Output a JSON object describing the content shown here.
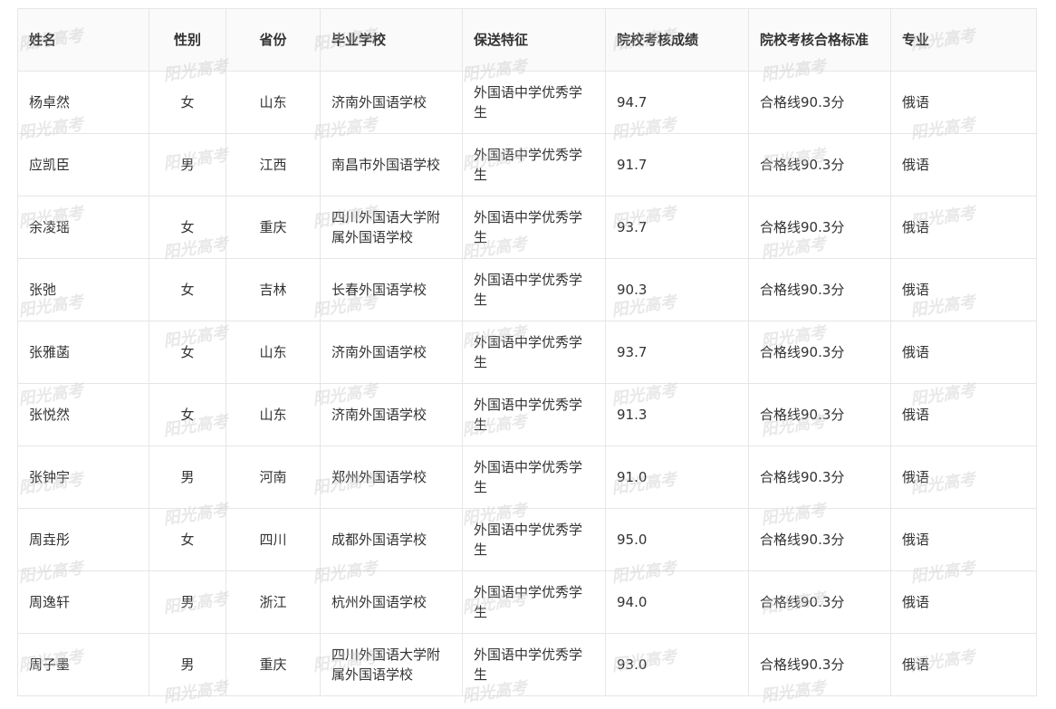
{
  "table": {
    "headers": [
      "姓名",
      "性别",
      "省份",
      "毕业学校",
      "保送特征",
      "院校考核成绩",
      "院校考核合格标准",
      "专业"
    ],
    "rows": [
      [
        "杨卓然",
        "女",
        "山东",
        "济南外国语学校",
        "外国语中学优秀学生",
        "94.7",
        "合格线90.3分",
        "俄语"
      ],
      [
        "应凯臣",
        "男",
        "江西",
        "南昌市外国语学校",
        "外国语中学优秀学生",
        "91.7",
        "合格线90.3分",
        "俄语"
      ],
      [
        "余凌瑶",
        "女",
        "重庆",
        "四川外国语大学附属外国语学校",
        "外国语中学优秀学生",
        "93.7",
        "合格线90.3分",
        "俄语"
      ],
      [
        "张弛",
        "女",
        "吉林",
        "长春外国语学校",
        "外国语中学优秀学生",
        "90.3",
        "合格线90.3分",
        "俄语"
      ],
      [
        "张雅菡",
        "女",
        "山东",
        "济南外国语学校",
        "外国语中学优秀学生",
        "93.7",
        "合格线90.3分",
        "俄语"
      ],
      [
        "张悦然",
        "女",
        "山东",
        "济南外国语学校",
        "外国语中学优秀学生",
        "91.3",
        "合格线90.3分",
        "俄语"
      ],
      [
        "张钟宇",
        "男",
        "河南",
        "郑州外国语学校",
        "外国语中学优秀学生",
        "91.0",
        "合格线90.3分",
        "俄语"
      ],
      [
        "周垚彤",
        "女",
        "四川",
        "成都外国语学校",
        "外国语中学优秀学生",
        "95.0",
        "合格线90.3分",
        "俄语"
      ],
      [
        "周逸轩",
        "男",
        "浙江",
        "杭州外国语学校",
        "外国语中学优秀学生",
        "94.0",
        "合格线90.3分",
        "俄语"
      ],
      [
        "周子墨",
        "男",
        "重庆",
        "四川外国语大学附属外国语学校",
        "外国语中学优秀学生",
        "93.0",
        "合格线90.3分",
        "俄语"
      ]
    ]
  },
  "watermark": {
    "text": "阳光高考"
  }
}
